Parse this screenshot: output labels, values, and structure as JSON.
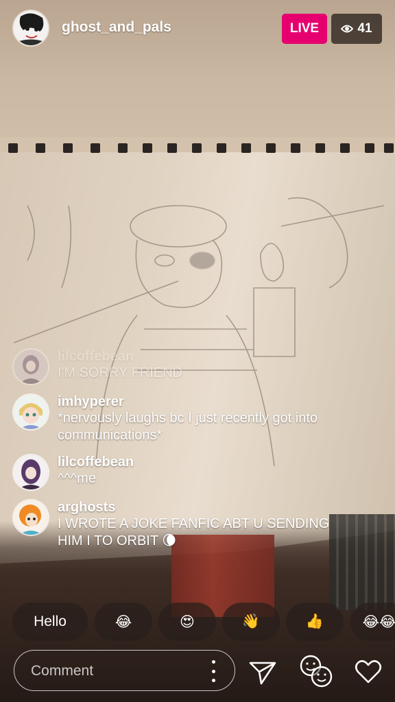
{
  "broadcast": {
    "host_username": "ghost_and_pals",
    "live_label": "LIVE",
    "viewer_count": "41"
  },
  "comments": [
    {
      "username": "lilcoffebean",
      "text": "I'M SORRY FRIEND",
      "faded": true
    },
    {
      "username": "imhyperer",
      "text": "*nervously laughs bc I just recently got into communications*"
    },
    {
      "username": "lilcoffebean",
      "text": "^^^me"
    },
    {
      "username": "arghosts",
      "text": "I WROTE A JOKE FANFIC ABT U SENDING HIM I TO ORBIT 🌘"
    }
  ],
  "quick_replies": [
    "Hello",
    "😂",
    "😍",
    "👋",
    "👍",
    "😂😂"
  ],
  "composer": {
    "placeholder": "Comment"
  },
  "icons": {
    "viewers": "eye-icon",
    "more": "more-vertical-icon",
    "send": "send-icon",
    "faces": "faces-icon",
    "like": "heart-icon"
  }
}
